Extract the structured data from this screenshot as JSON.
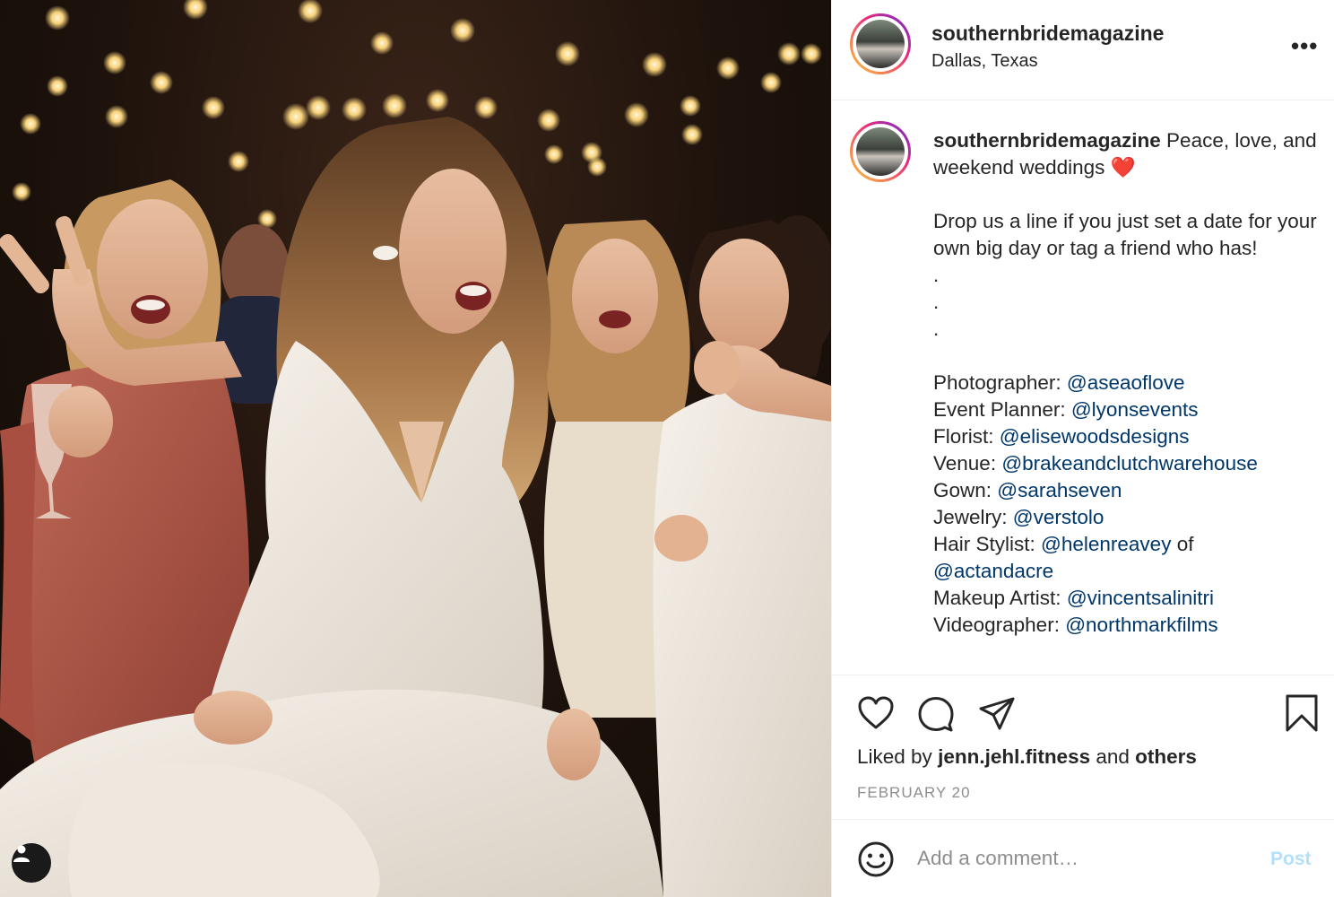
{
  "post": {
    "username": "southernbridemagazine",
    "location": "Dallas, Texas",
    "caption": {
      "username": "southernbridemagazine",
      "text_1": " Peace, love, and weekend weddings ",
      "emoji": "❤️",
      "text_2": "\n\nDrop us a line if you just set a date for your own big day or tag a friend who has!\n.\n.\n.\n\n",
      "credits": [
        {
          "role": "Photographer: ",
          "handle": "@aseaoflove"
        },
        {
          "role": "Event Planner: ",
          "handle": "@lyonsevents"
        },
        {
          "role": "Florist: ",
          "handle": "@elisewoodsdesigns"
        },
        {
          "role": "Venue: ",
          "handle": "@brakeandclutchwarehouse"
        },
        {
          "role": "Gown: ",
          "handle": "@sarahseven"
        },
        {
          "role": "Jewelry: ",
          "handle": "@verstolo"
        },
        {
          "role": "Hair Stylist: ",
          "handle": "@helenreavey",
          "suffix": " of ",
          "handle2": "@actandacre"
        },
        {
          "role": "Makeup Artist: ",
          "handle": "@vincentsalinitri"
        },
        {
          "role": "Videographer: ",
          "handle": "@northmarkfilms"
        }
      ]
    },
    "likes": {
      "prefix": "Liked by ",
      "user": "jenn.jehl.fitness",
      "middle": " and ",
      "others": "others"
    },
    "date": "FEBRUARY 20",
    "comment": {
      "placeholder": "Add a comment…",
      "post_label": "Post"
    },
    "icons": {
      "more": "more-options-icon",
      "like": "heart-icon",
      "comment": "comment-bubble-icon",
      "share": "paper-plane-icon",
      "save": "bookmark-icon",
      "emoji": "smiley-icon",
      "photo_user": "user-tag-icon"
    },
    "colors": {
      "link": "#00376b",
      "muted": "#8e8e8e",
      "post_disabled": "#b2dffc",
      "border": "#efefef"
    }
  }
}
